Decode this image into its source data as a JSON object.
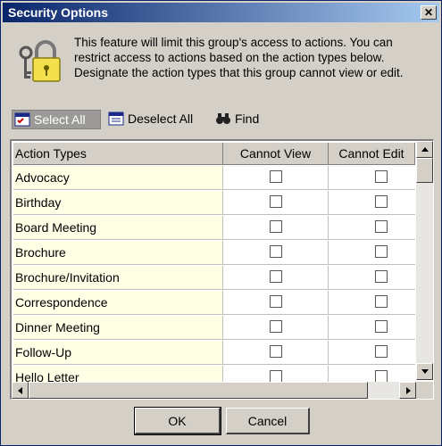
{
  "window": {
    "title": "Security Options",
    "close_glyph": "✕"
  },
  "description": "This feature will limit this group's access to actions.  You can restrict access to actions based on the action types below. Designate the action types that this group cannot view or edit.",
  "toolbar": {
    "select_all": "Select All",
    "deselect_all": "Deselect All",
    "find": "Find"
  },
  "grid": {
    "columns": [
      "Action Types",
      "Cannot View",
      "Cannot Edit"
    ],
    "rows": [
      {
        "type": "Advocacy",
        "cannot_view": false,
        "cannot_edit": false
      },
      {
        "type": "Birthday",
        "cannot_view": false,
        "cannot_edit": false
      },
      {
        "type": "Board Meeting",
        "cannot_view": false,
        "cannot_edit": false
      },
      {
        "type": "Brochure",
        "cannot_view": false,
        "cannot_edit": false
      },
      {
        "type": "Brochure/Invitation",
        "cannot_view": false,
        "cannot_edit": false
      },
      {
        "type": "Correspondence",
        "cannot_view": false,
        "cannot_edit": false
      },
      {
        "type": "Dinner Meeting",
        "cannot_view": false,
        "cannot_edit": false
      },
      {
        "type": "Follow-Up",
        "cannot_view": false,
        "cannot_edit": false
      },
      {
        "type": "Hello Letter",
        "cannot_view": false,
        "cannot_edit": false
      }
    ]
  },
  "buttons": {
    "ok": "OK",
    "cancel": "Cancel"
  },
  "icons": [
    "lock-keys-icon",
    "select-all-icon",
    "deselect-all-icon",
    "binoculars-icon"
  ]
}
